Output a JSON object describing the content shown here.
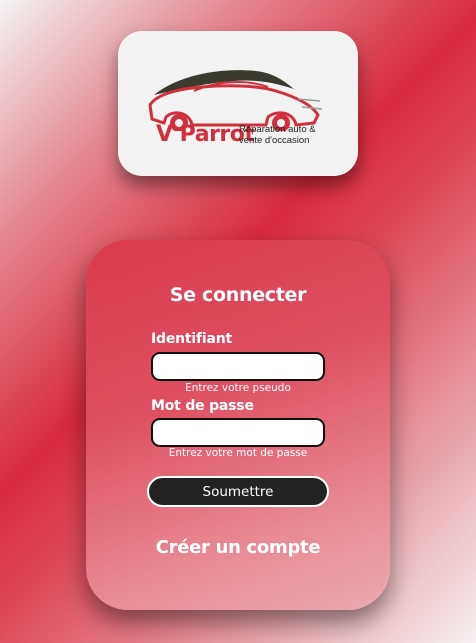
{
  "logo": {
    "brand": "V Parrot",
    "tagline_line1": "Réparation auto &",
    "tagline_line2": "vente d'occasion",
    "colors": {
      "red": "#d0303b",
      "dark": "#3b3a2e"
    }
  },
  "login": {
    "title": "Se connecter",
    "username_label": "Identifiant",
    "username_value": "",
    "username_hint": "Entrez votre pseudo",
    "password_label": "Mot de passe",
    "password_value": "",
    "password_hint": "Entrez votre mot de passe",
    "submit_label": "Soumettre",
    "create_account_label": "Créer un compte"
  },
  "theme": {
    "accent": "#d82a3e",
    "button": "#222222"
  }
}
